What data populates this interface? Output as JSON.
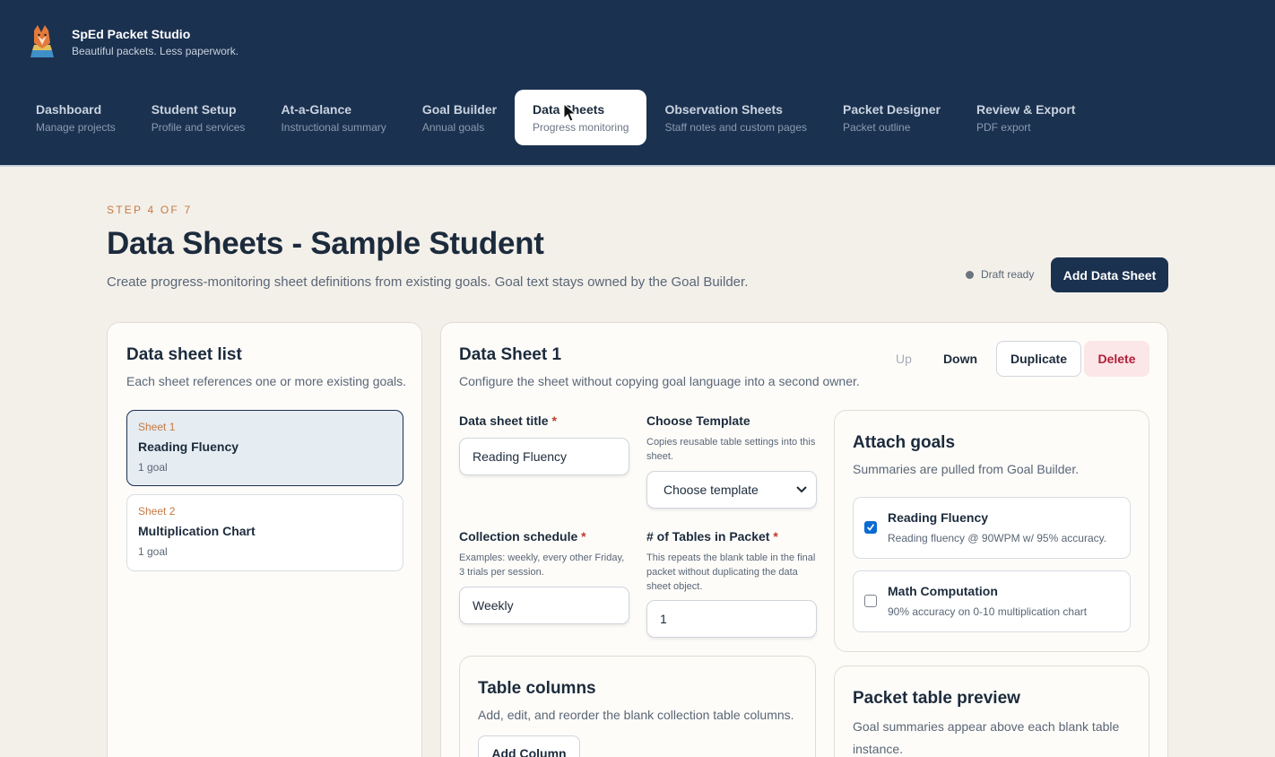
{
  "app": {
    "title": "SpEd Packet Studio",
    "tagline": "Beautiful packets. Less paperwork."
  },
  "nav": [
    {
      "title": "Dashboard",
      "sub": "Manage projects"
    },
    {
      "title": "Student Setup",
      "sub": "Profile and services"
    },
    {
      "title": "At-a-Glance",
      "sub": "Instructional summary"
    },
    {
      "title": "Goal Builder",
      "sub": "Annual goals"
    },
    {
      "title": "Data Sheets",
      "sub": "Progress monitoring",
      "active": true
    },
    {
      "title": "Observation Sheets",
      "sub": "Staff notes and custom pages"
    },
    {
      "title": "Packet Designer",
      "sub": "Packet outline"
    },
    {
      "title": "Review & Export",
      "sub": "PDF export"
    }
  ],
  "page": {
    "step": "STEP 4 OF 7",
    "title": "Data Sheets - Sample Student",
    "subtitle": "Create progress-monitoring sheet definitions from existing goals. Goal text stays owned by the Goal Builder.",
    "status": "Draft ready",
    "add_button": "Add Data Sheet"
  },
  "list": {
    "title": "Data sheet list",
    "subtitle": "Each sheet references one or more existing goals.",
    "items": [
      {
        "kicker": "Sheet 1",
        "name": "Reading Fluency",
        "meta": "1 goal",
        "selected": true
      },
      {
        "kicker": "Sheet 2",
        "name": "Multiplication Chart",
        "meta": "1 goal"
      }
    ]
  },
  "editor": {
    "title": "Data Sheet 1",
    "subtitle": "Configure the sheet without copying goal language into a second owner.",
    "actions": {
      "up": "Up",
      "down": "Down",
      "duplicate": "Duplicate",
      "delete": "Delete"
    },
    "fields": {
      "title_label": "Data sheet title",
      "title_value": "Reading Fluency",
      "template_label": "Choose Template",
      "template_help": "Copies reusable table settings into this sheet.",
      "template_value": "Choose template",
      "schedule_label": "Collection schedule",
      "schedule_help": "Examples: weekly, every other Friday, 3 trials per session.",
      "schedule_value": "Weekly",
      "tables_label": "# of Tables in Packet",
      "tables_help": "This repeats the blank table in the final packet without duplicating the data sheet object.",
      "tables_value": "1",
      "required_mark": "*"
    },
    "columns": {
      "title": "Table columns",
      "subtitle": "Add, edit, and reorder the blank collection table columns.",
      "add_button": "Add Column"
    },
    "attach": {
      "title": "Attach goals",
      "subtitle": "Summaries are pulled from Goal Builder.",
      "goals": [
        {
          "name": "Reading Fluency",
          "summary": "Reading fluency @ 90WPM w/ 95% accuracy.",
          "checked": true
        },
        {
          "name": "Math Computation",
          "summary": "90% accuracy on 0-10 multiplication chart",
          "checked": false
        }
      ]
    },
    "preview": {
      "title": "Packet table preview",
      "subtitle": "Goal summaries appear above each blank table instance."
    }
  },
  "colors": {
    "navy": "#1b3150",
    "accent": "#c47a43",
    "danger": "#b0203a",
    "checkbox": "#0a6cd1"
  }
}
